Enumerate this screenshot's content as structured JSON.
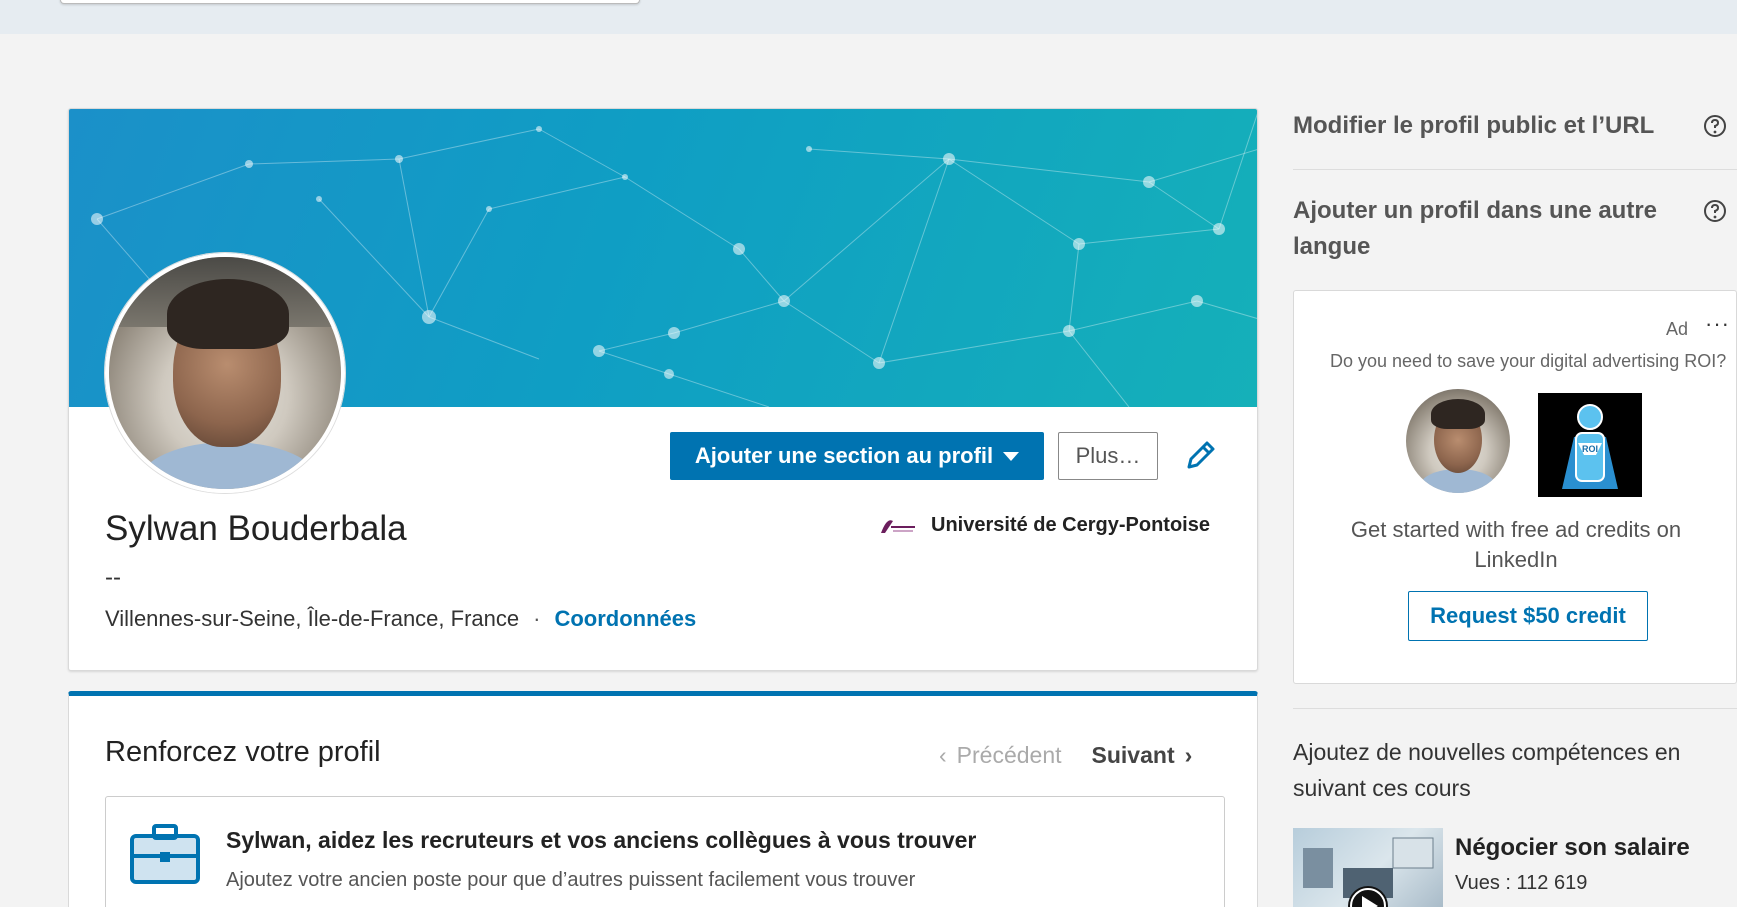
{
  "profile": {
    "name": "Sylwan Bouderbala",
    "headline": "--",
    "location": "Villennes-sur-Seine, Île-de-France, France",
    "separator": "·",
    "contact_link": "Coordonnées",
    "school": "Université de Cergy-Pontoise",
    "add_section_button": "Ajouter une section au profil",
    "more_button": "Plus…"
  },
  "strengthen": {
    "title": "Renforcez votre profil",
    "prev_label": "Précédent",
    "next_label": "Suivant",
    "suggestion_title": "Sylwan, aidez les recruteurs et vos anciens collègues à vous trouver",
    "suggestion_text": "Ajoutez votre ancien poste pour que d’autres puissent facilement vous trouver"
  },
  "sidebar": {
    "edit_public_profile": "Modifier le profil public et l’URL",
    "add_language_profile": "Ajouter un profil dans une autre langue"
  },
  "ad": {
    "label": "Ad",
    "menu": "···",
    "question": "Do you need to save your digital advertising ROI?",
    "body": "Get started with free ad credits on LinkedIn",
    "button": "Request $50 credit",
    "roi_badge": "ROI"
  },
  "courses": {
    "title": "Ajoutez de nouvelles compétences en suivant ces cours",
    "items": [
      {
        "title": "Négocier son salaire",
        "views": "Vues : 112 619"
      }
    ]
  },
  "colors": {
    "accent": "#0073b1",
    "banner_start": "#1b90c9",
    "banner_end": "#15b0b9"
  }
}
